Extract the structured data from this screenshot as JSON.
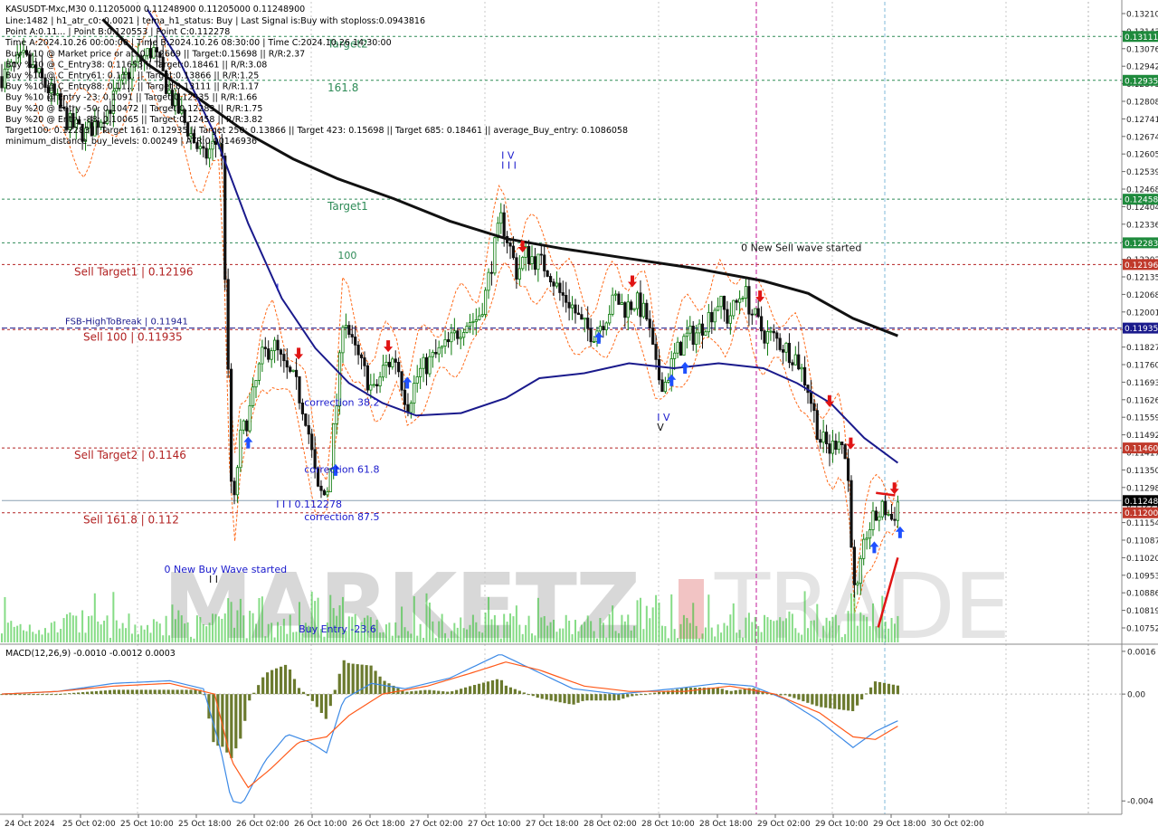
{
  "header": {
    "symbol_line": "KASUSDT-Mxc,M30  0.11205000 0.11248900 0.11205000 0.11248900",
    "lines": [
      "Line:1482 | h1_atr_c0: 0.0021 | tema_h1_status: Buy | Last Signal is:Buy with stoploss:0.0943816",
      "Point A:0.11... | Point B:0.120553 | Point C:0.112278",
      "Time A:2024.10.26 00:00:00 | Time B:2024.10.26 08:30:00 | Time C:2024.10.26 14:30:00",
      "Buy %10 @ Market price or at: 0.112669 || Target:0.15698 || R/R:2.37",
      "Buy %20 @ C_Entry38: 0.11653 || Target:0.18461 || R/R:3.08",
      "Buy %10 @ C_Entry61: 0.11... || Target:0.13866 || R/R:1.25",
      "Buy %10 @ C_Entry88: 0.11... || Target:0.13111 || R/R:1.17",
      "Buy %10 @ Entry -23: 0.1091 || Target:0.12935 || R/R:1.66",
      "Buy %20 @ Entry -50: 0.10472 || Target:0.12283 || R/R:1.75",
      "Buy %20 @ Entry -88: 0.10065 || Target:0.12458 || R/R:3.82",
      "Target100: 0.12283 || Target 161: 0.12935 || Target 250: 0.13866 || Target 423: 0.15698 || Target 685: 0.18461 || average_Buy_entry: 0.1086058",
      "minimum_distance_buy_levels: 0.00249 | ATR:0.00146936"
    ]
  },
  "watermark": {
    "left": "MARKETZ",
    "right": "TRADE"
  },
  "colors": {
    "bull": "#0a7a0a",
    "bear": "#111111",
    "ma_slow": "#111111",
    "ma_fast": "#1a1a8c",
    "envelope": "#ff6a1a",
    "level_red": "#b22222",
    "level_green": "#2e8b57",
    "level_blue": "#1a1a8c",
    "macd_hist": "#6b7a2e",
    "macd_line": "#3d8ae6",
    "signal_line": "#ff5a1a",
    "buy_arrow": "#1e50ff",
    "sell_arrow": "#e01414"
  },
  "axis": {
    "price_ticks": [
      "0.13210",
      "0.13143",
      "0.13076",
      "0.12942",
      "0.12875",
      "0.12808",
      "0.12741",
      "0.12674",
      "0.12605",
      "0.12539",
      "0.12468",
      "0.12404",
      "0.12336",
      "0.12250",
      "0.12202",
      "0.12135",
      "0.12068",
      "0.12001",
      "0.11894",
      "0.11827",
      "0.11760",
      "0.11693",
      "0.11626",
      "0.11559",
      "0.11492",
      "0.11417",
      "0.11350",
      "0.11298",
      "0.11221",
      "0.11154",
      "0.11087",
      "0.11020",
      "0.10953",
      "0.10886",
      "0.10819",
      "0.10752",
      "0.10685"
    ],
    "time_labels": [
      "24 Oct 2024",
      "25 Oct 02:00",
      "25 Oct 10:00",
      "25 Oct 18:00",
      "26 Oct 02:00",
      "26 Oct 10:00",
      "26 Oct 18:00",
      "27 Oct 02:00",
      "27 Oct 10:00",
      "27 Oct 18:00",
      "28 Oct 02:00",
      "28 Oct 10:00",
      "28 Oct 18:00",
      "29 Oct 02:00",
      "29 Oct 10:00",
      "29 Oct 18:00",
      "30 Oct 02:00"
    ],
    "macd_ticks": [
      "0.0016",
      "0.00",
      "-0.004"
    ]
  },
  "levels": [
    {
      "price": 0.13111,
      "label": "Target2",
      "label_x_frac": 0.36,
      "color": "green",
      "tag": "0.13111"
    },
    {
      "price": 0.12935,
      "label": "161.8",
      "label_x_frac": 0.36,
      "color": "green",
      "tag": "0.12935"
    },
    {
      "price": 0.12458,
      "label": "Target1",
      "label_x_frac": 0.36,
      "color": "green",
      "tag": "0.12458"
    },
    {
      "price": 0.12283,
      "label": "",
      "label_x_frac": 0,
      "color": "green",
      "tag": "0.12283"
    },
    {
      "price": 0.12196,
      "label": "Sell Target1 | 0.12196",
      "label_x_frac": 0.08,
      "color": "red",
      "tag": "0.12196"
    },
    {
      "price": 0.11941,
      "label": "FSB-HighToBreak | 0.11941",
      "label_x_frac": 0.07,
      "color": "blue",
      "tag": "0.11935"
    },
    {
      "price": 0.11935,
      "label": "Sell 100 | 0.11935",
      "label_x_frac": 0.09,
      "color": "red",
      "tag": ""
    },
    {
      "price": 0.1146,
      "label": "Sell Target2 | 0.1146",
      "label_x_frac": 0.08,
      "color": "red",
      "tag": "0.11460"
    },
    {
      "price": 0.112,
      "label": "Sell 161.8 | 0.112",
      "label_x_frac": 0.09,
      "color": "red",
      "tag": "0.11200"
    }
  ],
  "current_price": {
    "price": 0.112489,
    "tag": "0.11248"
  },
  "annotations": [
    {
      "text": "I V",
      "t": 0.446,
      "price": 0.1262,
      "color": "blue"
    },
    {
      "text": "I I I",
      "t": 0.446,
      "price": 0.1258,
      "color": "blue"
    },
    {
      "text": "0 New Sell wave started",
      "t": 0.66,
      "price": 0.1225,
      "color": "black"
    },
    {
      "text": "I V",
      "t": 0.585,
      "price": 0.1157,
      "color": "blue"
    },
    {
      "text": "V",
      "t": 0.585,
      "price": 0.1153,
      "color": "black"
    },
    {
      "text": "100",
      "t": 0.3,
      "price": 0.1222,
      "color": "green"
    },
    {
      "text": "correction 38.2",
      "t": 0.27,
      "price": 0.1163,
      "color": "blue"
    },
    {
      "text": "correction 61.8",
      "t": 0.27,
      "price": 0.1136,
      "color": "blue"
    },
    {
      "text": "correction 87.5",
      "t": 0.27,
      "price": 0.1117,
      "color": "blue"
    },
    {
      "text": "I I I 0.112278",
      "t": 0.245,
      "price": 0.1122,
      "color": "blue"
    },
    {
      "text": "0 New Buy Wave started",
      "t": 0.145,
      "price": 0.1096,
      "color": "blue"
    },
    {
      "text": "I I",
      "t": 0.185,
      "price": 0.1092,
      "color": "black"
    },
    {
      "text": "Buy Entry -23.6",
      "t": 0.265,
      "price": 0.1072,
      "color": "blue"
    },
    {
      "text": "I",
      "t": 0.245,
      "price": 0.1209,
      "color": "blue"
    },
    {
      "text": "0.1218...",
      "t": 0.115,
      "price": 0.1326,
      "color": "black"
    }
  ],
  "macd": {
    "label": "MACD(12,26,9) -0.0010 -0.0012 0.0003",
    "range": [
      -0.0045,
      0.0018
    ]
  },
  "chart_data": {
    "type": "candlestick",
    "title": "KASUSDT-Mxc,M30",
    "xlabel": "",
    "ylabel": "",
    "ylim": [
      0.1068,
      0.1325
    ],
    "grid": false,
    "x_range": [
      "24 Oct 2024",
      "30 Oct 2024"
    ],
    "price_path": [
      [
        0.0,
        0.1295
      ],
      [
        0.02,
        0.1302
      ],
      [
        0.045,
        0.1288
      ],
      [
        0.06,
        0.1276
      ],
      [
        0.075,
        0.1272
      ],
      [
        0.095,
        0.1282
      ],
      [
        0.115,
        0.1298
      ],
      [
        0.135,
        0.1306
      ],
      [
        0.15,
        0.1288
      ],
      [
        0.165,
        0.1275
      ],
      [
        0.18,
        0.1262
      ],
      [
        0.19,
        0.1268
      ],
      [
        0.196,
        0.127
      ],
      [
        0.2,
        0.1205
      ],
      [
        0.206,
        0.1115
      ],
      [
        0.212,
        0.1148
      ],
      [
        0.222,
        0.1162
      ],
      [
        0.232,
        0.1182
      ],
      [
        0.242,
        0.1188
      ],
      [
        0.252,
        0.1178
      ],
      [
        0.262,
        0.1172
      ],
      [
        0.272,
        0.1158
      ],
      [
        0.282,
        0.1128
      ],
      [
        0.29,
        0.1127
      ],
      [
        0.3,
        0.1168
      ],
      [
        0.305,
        0.1202
      ],
      [
        0.312,
        0.1188
      ],
      [
        0.322,
        0.1178
      ],
      [
        0.332,
        0.1168
      ],
      [
        0.342,
        0.1179
      ],
      [
        0.352,
        0.1182
      ],
      [
        0.362,
        0.1163
      ],
      [
        0.372,
        0.1176
      ],
      [
        0.385,
        0.1182
      ],
      [
        0.4,
        0.1188
      ],
      [
        0.412,
        0.1196
      ],
      [
        0.425,
        0.1198
      ],
      [
        0.432,
        0.1208
      ],
      [
        0.438,
        0.1222
      ],
      [
        0.446,
        0.1238
      ],
      [
        0.452,
        0.1229
      ],
      [
        0.46,
        0.1216
      ],
      [
        0.468,
        0.1224
      ],
      [
        0.478,
        0.1221
      ],
      [
        0.488,
        0.1218
      ],
      [
        0.498,
        0.1208
      ],
      [
        0.508,
        0.1204
      ],
      [
        0.518,
        0.1195
      ],
      [
        0.528,
        0.1192
      ],
      [
        0.538,
        0.1198
      ],
      [
        0.548,
        0.1206
      ],
      [
        0.556,
        0.1202
      ],
      [
        0.566,
        0.1205
      ],
      [
        0.576,
        0.1198
      ],
      [
        0.585,
        0.1175
      ],
      [
        0.592,
        0.1172
      ],
      [
        0.6,
        0.1182
      ],
      [
        0.61,
        0.119
      ],
      [
        0.62,
        0.1192
      ],
      [
        0.63,
        0.1198
      ],
      [
        0.64,
        0.1205
      ],
      [
        0.648,
        0.1198
      ],
      [
        0.655,
        0.1203
      ],
      [
        0.662,
        0.121
      ],
      [
        0.67,
        0.12
      ],
      [
        0.68,
        0.1192
      ],
      [
        0.69,
        0.119
      ],
      [
        0.7,
        0.1186
      ],
      [
        0.71,
        0.1182
      ],
      [
        0.72,
        0.117
      ],
      [
        0.73,
        0.115
      ],
      [
        0.74,
        0.1145
      ],
      [
        0.748,
        0.1152
      ],
      [
        0.755,
        0.1138
      ],
      [
        0.762,
        0.1082
      ],
      [
        0.766,
        0.1095
      ],
      [
        0.772,
        0.1112
      ],
      [
        0.78,
        0.1118
      ],
      [
        0.788,
        0.1122
      ],
      [
        0.795,
        0.1117
      ],
      [
        0.8,
        0.1124
      ]
    ],
    "series": [
      {
        "name": "",
        "kind": "ma_slow",
        "points": [
          [
            0.09,
            0.1318
          ],
          [
            0.13,
            0.13
          ],
          [
            0.17,
            0.1288
          ],
          [
            0.22,
            0.1272
          ],
          [
            0.26,
            0.1262
          ],
          [
            0.3,
            0.1254
          ],
          [
            0.35,
            0.1246
          ],
          [
            0.4,
            0.1237
          ],
          [
            0.45,
            0.123
          ],
          [
            0.5,
            0.1226
          ],
          [
            0.56,
            0.1222
          ],
          [
            0.62,
            0.1218
          ],
          [
            0.68,
            0.1213
          ],
          [
            0.72,
            0.1208
          ],
          [
            0.76,
            0.1198
          ],
          [
            0.8,
            0.1191
          ]
        ]
      },
      {
        "name": "",
        "kind": "ma_fast",
        "points": [
          [
            0.13,
            0.1322
          ],
          [
            0.16,
            0.13
          ],
          [
            0.19,
            0.1272
          ],
          [
            0.22,
            0.1236
          ],
          [
            0.25,
            0.1206
          ],
          [
            0.28,
            0.1186
          ],
          [
            0.31,
            0.1172
          ],
          [
            0.34,
            0.1164
          ],
          [
            0.37,
            0.1159
          ],
          [
            0.41,
            0.116
          ],
          [
            0.45,
            0.1166
          ],
          [
            0.48,
            0.1174
          ],
          [
            0.52,
            0.1176
          ],
          [
            0.56,
            0.118
          ],
          [
            0.6,
            0.1178
          ],
          [
            0.64,
            0.118
          ],
          [
            0.68,
            0.1178
          ],
          [
            0.71,
            0.1172
          ],
          [
            0.74,
            0.1164
          ],
          [
            0.77,
            0.115
          ],
          [
            0.8,
            0.114
          ]
        ]
      }
    ],
    "macd_series": [
      {
        "name": "MACD",
        "points": [
          [
            0.0,
            0.0
          ],
          [
            0.05,
            0.0001
          ],
          [
            0.1,
            0.0004
          ],
          [
            0.15,
            0.0005
          ],
          [
            0.18,
            0.0002
          ],
          [
            0.195,
            -0.002
          ],
          [
            0.205,
            -0.004
          ],
          [
            0.215,
            -0.0041
          ],
          [
            0.235,
            -0.0025
          ],
          [
            0.255,
            -0.0015
          ],
          [
            0.275,
            -0.0018
          ],
          [
            0.29,
            -0.0022
          ],
          [
            0.305,
            -0.0002
          ],
          [
            0.33,
            0.0004
          ],
          [
            0.36,
            0.0002
          ],
          [
            0.4,
            0.0006
          ],
          [
            0.445,
            0.0015
          ],
          [
            0.47,
            0.001
          ],
          [
            0.51,
            0.0002
          ],
          [
            0.55,
            0.0
          ],
          [
            0.6,
            0.0002
          ],
          [
            0.64,
            0.0004
          ],
          [
            0.67,
            0.0003
          ],
          [
            0.7,
            -0.0002
          ],
          [
            0.73,
            -0.001
          ],
          [
            0.76,
            -0.002
          ],
          [
            0.78,
            -0.0014
          ],
          [
            0.8,
            -0.001
          ]
        ]
      },
      {
        "name": "Signal",
        "points": [
          [
            0.0,
            0.0
          ],
          [
            0.05,
            0.0001
          ],
          [
            0.1,
            0.0003
          ],
          [
            0.15,
            0.0004
          ],
          [
            0.19,
            0.0
          ],
          [
            0.205,
            -0.0025
          ],
          [
            0.22,
            -0.0035
          ],
          [
            0.24,
            -0.0028
          ],
          [
            0.265,
            -0.0018
          ],
          [
            0.29,
            -0.0016
          ],
          [
            0.31,
            -0.0008
          ],
          [
            0.34,
            0.0
          ],
          [
            0.38,
            0.0003
          ],
          [
            0.42,
            0.0008
          ],
          [
            0.45,
            0.0012
          ],
          [
            0.48,
            0.0009
          ],
          [
            0.52,
            0.0003
          ],
          [
            0.56,
            0.0001
          ],
          [
            0.61,
            0.0001
          ],
          [
            0.65,
            0.0003
          ],
          [
            0.69,
            0.0
          ],
          [
            0.73,
            -0.0007
          ],
          [
            0.76,
            -0.0016
          ],
          [
            0.78,
            -0.0017
          ],
          [
            0.8,
            -0.0012
          ]
        ]
      }
    ],
    "signals": [
      {
        "type": "buy",
        "t": 0.22,
        "price": 0.1148
      },
      {
        "type": "sell",
        "t": 0.265,
        "price": 0.1184
      },
      {
        "type": "buy",
        "t": 0.298,
        "price": 0.1137
      },
      {
        "type": "sell",
        "t": 0.345,
        "price": 0.1187
      },
      {
        "type": "buy",
        "t": 0.362,
        "price": 0.1172
      },
      {
        "type": "sell",
        "t": 0.465,
        "price": 0.1227
      },
      {
        "type": "buy",
        "t": 0.533,
        "price": 0.119
      },
      {
        "type": "sell",
        "t": 0.563,
        "price": 0.1213
      },
      {
        "type": "buy",
        "t": 0.598,
        "price": 0.1173
      },
      {
        "type": "buy",
        "t": 0.61,
        "price": 0.1178
      },
      {
        "type": "sell",
        "t": 0.677,
        "price": 0.1207
      },
      {
        "type": "sell",
        "t": 0.739,
        "price": 0.1165
      },
      {
        "type": "sell",
        "t": 0.758,
        "price": 0.1148
      },
      {
        "type": "buy",
        "t": 0.779,
        "price": 0.1106
      },
      {
        "type": "sell",
        "t": 0.797,
        "price": 0.113
      },
      {
        "type": "buy",
        "t": 0.802,
        "price": 0.1112
      }
    ]
  }
}
